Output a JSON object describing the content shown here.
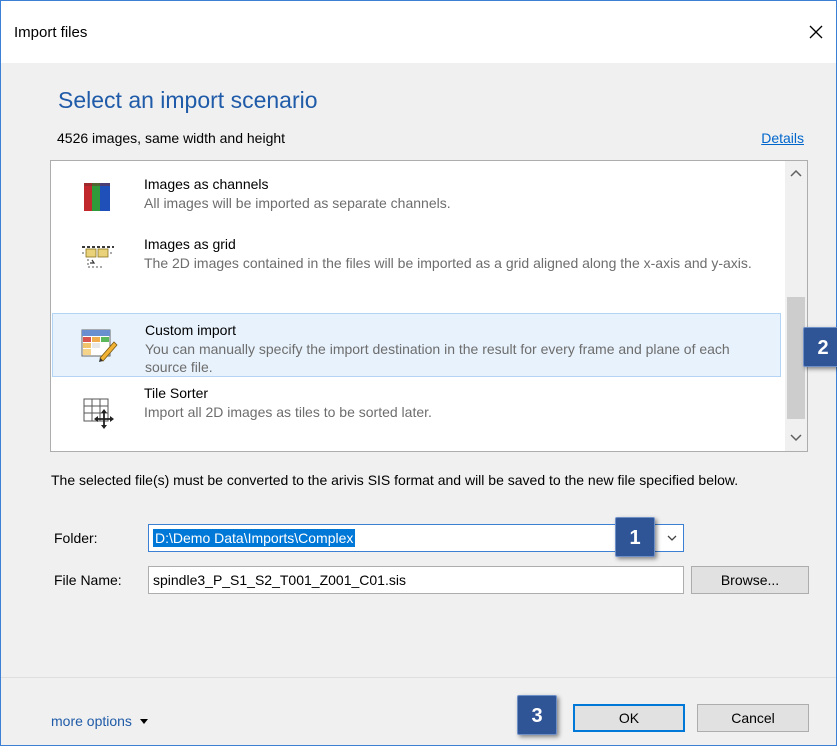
{
  "window": {
    "title": "Import files"
  },
  "heading": "Select an import scenario",
  "summary": "4526 images, same width and height",
  "details_link": "Details",
  "scenarios": [
    {
      "title": "Images as channels",
      "desc": "All images will be imported as separate channels.",
      "icon": "channels-icon"
    },
    {
      "title": "Images as grid",
      "desc": "The 2D images contained in the files will be imported as a grid aligned along the x-axis and y-axis.",
      "icon": "grid-icon"
    },
    {
      "title": "Custom import",
      "desc": "You can manually specify the import destination in the result for every frame and plane of each source file.",
      "icon": "custom-import-icon",
      "selected": true
    },
    {
      "title": "Tile Sorter",
      "desc": "Import all 2D images as tiles to be sorted later.",
      "icon": "tile-sorter-icon"
    }
  ],
  "info_text": "The selected file(s) must be converted to the arivis SIS format and will be saved to the new file specified below.",
  "folder": {
    "label": "Folder:",
    "value": "D:\\Demo Data\\Imports\\Complex"
  },
  "file_name": {
    "label": "File Name:",
    "value": "spindle3_P_S1_S2_T001_Z001_C01.sis"
  },
  "buttons": {
    "browse": "Browse...",
    "ok": "OK",
    "cancel": "Cancel"
  },
  "more_options": "more options",
  "callouts": {
    "one": "1",
    "two": "2",
    "three": "3"
  },
  "colors": {
    "accent": "#0078d7",
    "heading": "#1f5ba8",
    "callout": "#2f5597"
  }
}
